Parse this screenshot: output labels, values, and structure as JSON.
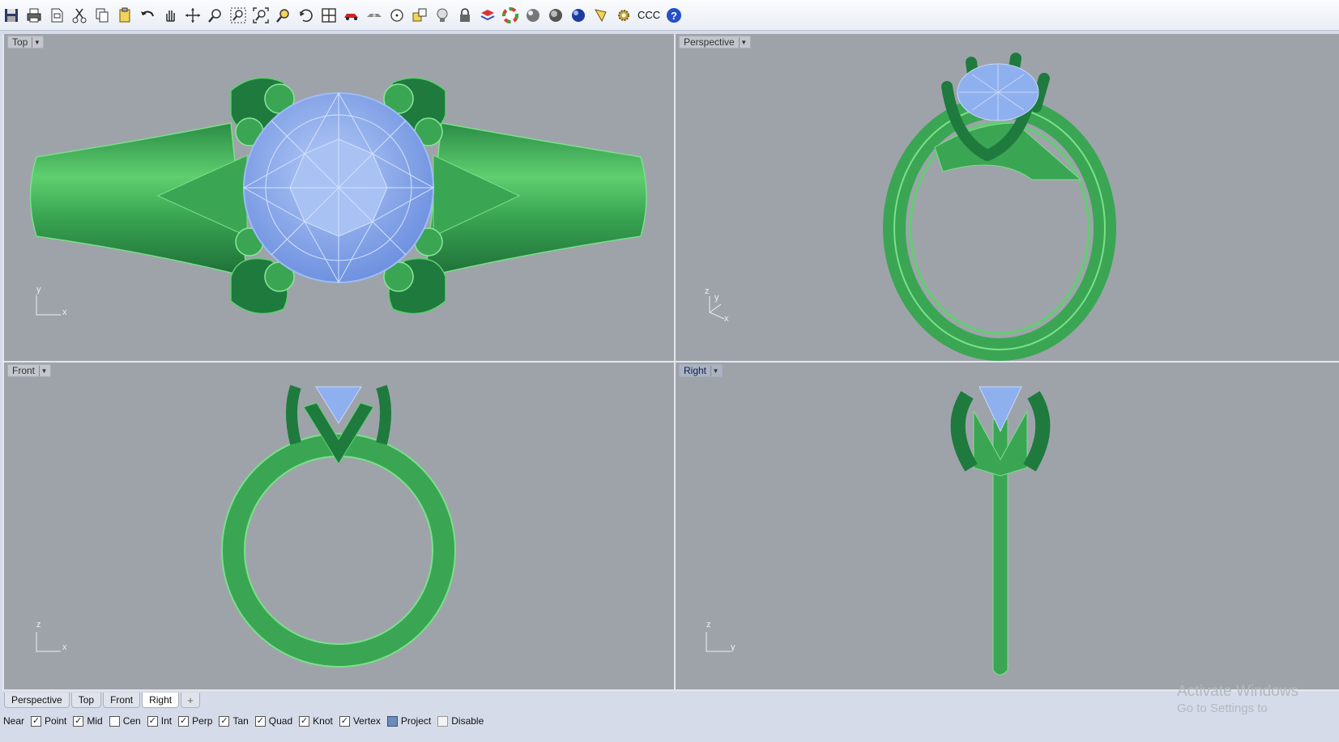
{
  "toolbar": {
    "icons": [
      "save-icon",
      "print-icon",
      "new-icon",
      "cut-icon",
      "copy-icon",
      "paste-icon",
      "undo-icon",
      "pan-hand-icon",
      "move-view-icon",
      "zoom-icon",
      "zoom-window-icon",
      "zoom-extents-icon",
      "zoom-selected-icon",
      "rotate-view-icon",
      "grid-layout-icon",
      "car-icon",
      "render-icon",
      "circle-icon",
      "snap-icon",
      "bulb-icon",
      "lock-icon",
      "layer-icon",
      "color-wheel-icon",
      "sphere-gray-icon",
      "sphere-shaded-icon",
      "sphere-blue-icon",
      "pencil-icon",
      "gear-icon"
    ],
    "text_button": "CCC",
    "help_icon": "help-icon"
  },
  "viewports": {
    "top": {
      "title": "Top",
      "axis1": "y",
      "axis2": "x"
    },
    "perspective": {
      "title": "Perspective",
      "axis1": "z",
      "axis2": "y",
      "axis3": "x"
    },
    "front": {
      "title": "Front",
      "axis1": "z",
      "axis2": "x"
    },
    "right": {
      "title": "Right",
      "axis1": "z",
      "axis2": "y"
    }
  },
  "tabs": [
    "Perspective",
    "Top",
    "Front",
    "Right"
  ],
  "tab_add": "+",
  "statusbar": {
    "near": "Near",
    "items": [
      {
        "label": "Point",
        "checked": true
      },
      {
        "label": "Mid",
        "checked": true
      },
      {
        "label": "Cen",
        "checked": false
      },
      {
        "label": "Int",
        "checked": true
      },
      {
        "label": "Perp",
        "checked": true
      },
      {
        "label": "Tan",
        "checked": true
      },
      {
        "label": "Quad",
        "checked": true
      },
      {
        "label": "Knot",
        "checked": true
      },
      {
        "label": "Vertex",
        "checked": true
      }
    ],
    "project": "Project",
    "disable": "Disable"
  },
  "watermark": {
    "line1": "Activate Windows",
    "line2": "Go to Settings to"
  },
  "colors": {
    "viewport_bg": "#9ea3aa",
    "ring_green": "#4fc25d",
    "ring_dark": "#1f7a3e",
    "gem_blue": "#8fb0ef"
  }
}
